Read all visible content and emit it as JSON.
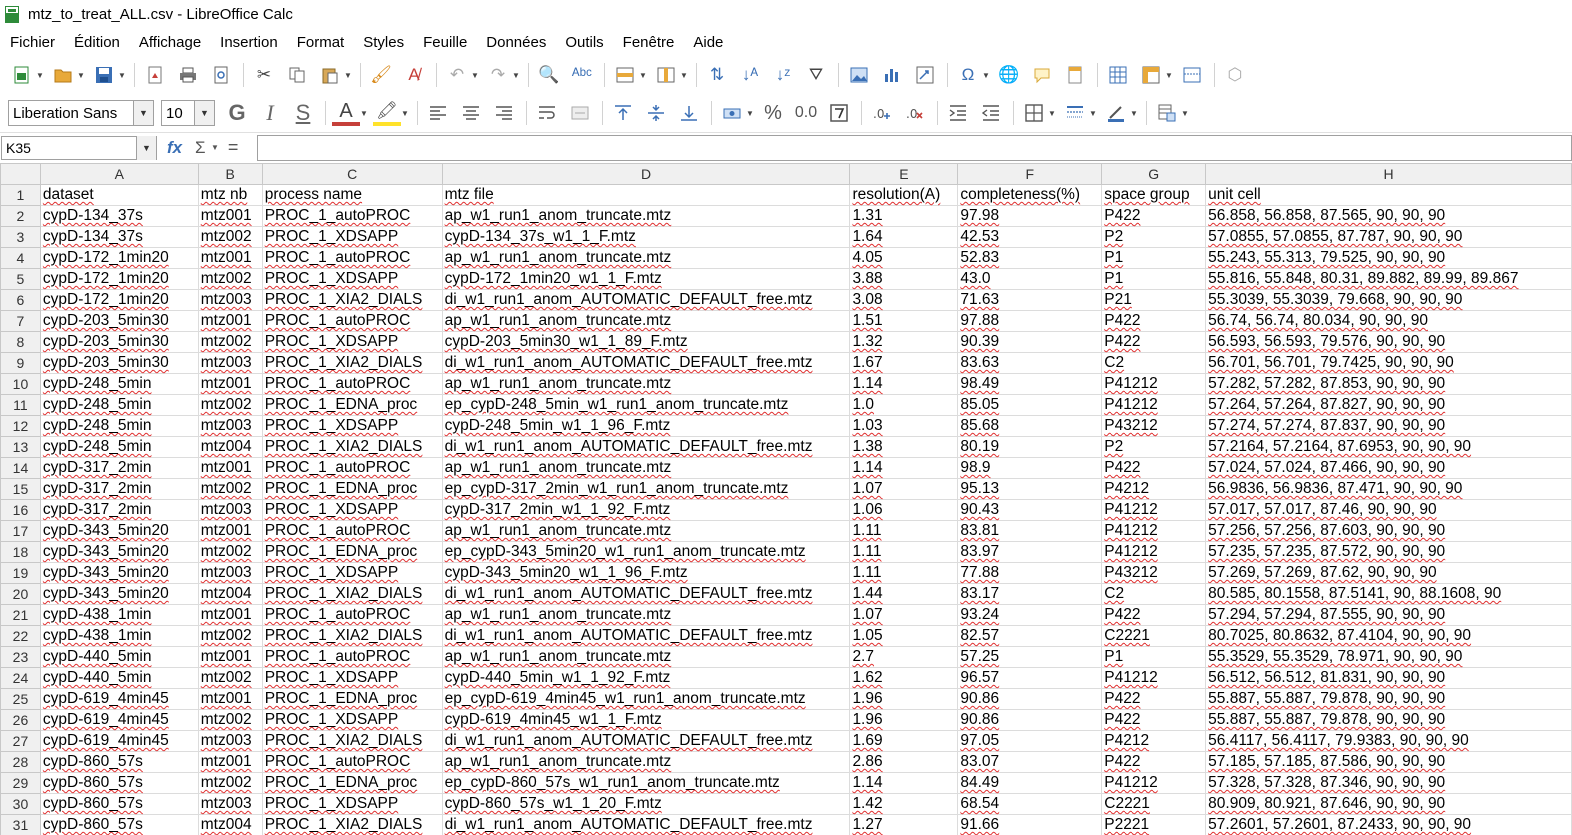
{
  "window": {
    "title": "mtz_to_treat_ALL.csv - LibreOffice Calc"
  },
  "menu": [
    "Fichier",
    "Édition",
    "Affichage",
    "Insertion",
    "Format",
    "Styles",
    "Feuille",
    "Données",
    "Outils",
    "Fenêtre",
    "Aide"
  ],
  "format_toolbar": {
    "font_name": "Liberation Sans",
    "font_size": "10",
    "percent_label": "%",
    "decimal_label": "0.0"
  },
  "formula_bar": {
    "cell_ref": "K35",
    "formula": ""
  },
  "columns": [
    "A",
    "B",
    "C",
    "D",
    "E",
    "F",
    "G",
    "H"
  ],
  "header_row": [
    "dataset",
    "mtz nb",
    "process name",
    "mtz file",
    "resolution(A)",
    "completeness(%)",
    "space group",
    "unit cell"
  ],
  "rows": [
    [
      "cypD-134_37s",
      "mtz001",
      "PROC_1_autoPROC",
      "ap_w1_run1_anom_truncate.mtz",
      "1.31",
      "97.98",
      "P422",
      "56.858, 56.858, 87.565, 90, 90, 90"
    ],
    [
      "cypD-134_37s",
      "mtz002",
      "PROC_1_XDSAPP",
      "cypD-134_37s_w1_1_F.mtz",
      "1.64",
      "42.53",
      "P2",
      "57.0855, 57.0855, 87.787, 90, 90, 90"
    ],
    [
      "cypD-172_1min20",
      "mtz001",
      "PROC_1_autoPROC",
      "ap_w1_run1_anom_truncate.mtz",
      "4.05",
      "52.83",
      "P1",
      "55.243, 55.313, 79.525, 90, 90, 90"
    ],
    [
      "cypD-172_1min20",
      "mtz002",
      "PROC_1_XDSAPP",
      "cypD-172_1min20_w1_1_F.mtz",
      "3.88",
      "43.0",
      "P1",
      "55.816, 55.848, 80.31, 89.882, 89.99, 89.867"
    ],
    [
      "cypD-172_1min20",
      "mtz003",
      "PROC_1_XIA2_DIALS",
      "di_w1_run1_anom_AUTOMATIC_DEFAULT_free.mtz",
      "3.08",
      "71.63",
      "P21",
      "55.3039, 55.3039, 79.668, 90, 90, 90"
    ],
    [
      "cypD-203_5min30",
      "mtz001",
      "PROC_1_autoPROC",
      "ap_w1_run1_anom_truncate.mtz",
      "1.51",
      "97.88",
      "P422",
      "56.74, 56.74, 80.034, 90, 90, 90"
    ],
    [
      "cypD-203_5min30",
      "mtz002",
      "PROC_1_XDSAPP",
      "cypD-203_5min30_w1_1_89_F.mtz",
      "1.32",
      "90.39",
      "P422",
      "56.593, 56.593, 79.576, 90, 90, 90"
    ],
    [
      "cypD-203_5min30",
      "mtz003",
      "PROC_1_XIA2_DIALS",
      "di_w1_run1_anom_AUTOMATIC_DEFAULT_free.mtz",
      "1.67",
      "83.63",
      "C2",
      "56.701, 56.701, 79.7425, 90, 90, 90"
    ],
    [
      "cypD-248_5min",
      "mtz001",
      "PROC_1_autoPROC",
      "ap_w1_run1_anom_truncate.mtz",
      "1.14",
      "98.49",
      "P41212",
      "57.282, 57.282, 87.853, 90, 90, 90"
    ],
    [
      "cypD-248_5min",
      "mtz002",
      "PROC_1_EDNA_proc",
      "ep_cypD-248_5min_w1_run1_anom_truncate.mtz",
      "1.0",
      "85.05",
      "P41212",
      "57.264, 57.264, 87.827, 90, 90, 90"
    ],
    [
      "cypD-248_5min",
      "mtz003",
      "PROC_1_XDSAPP",
      "cypD-248_5min_w1_1_96_F.mtz",
      "1.03",
      "85.68",
      "P43212",
      "57.274, 57.274, 87.837, 90, 90, 90"
    ],
    [
      "cypD-248_5min",
      "mtz004",
      "PROC_1_XIA2_DIALS",
      "di_w1_run1_anom_AUTOMATIC_DEFAULT_free.mtz",
      "1.38",
      "80.19",
      "P2",
      "57.2164, 57.2164, 87.6953, 90, 90, 90"
    ],
    [
      "cypD-317_2min",
      "mtz001",
      "PROC_1_autoPROC",
      "ap_w1_run1_anom_truncate.mtz",
      "1.14",
      "98.9",
      "P422",
      "57.024, 57.024, 87.466, 90, 90, 90"
    ],
    [
      "cypD-317_2min",
      "mtz002",
      "PROC_1_EDNA_proc",
      "ep_cypD-317_2min_w1_run1_anom_truncate.mtz",
      "1.07",
      "95.13",
      "P4212",
      "56.9836, 56.9836, 87.471, 90, 90, 90"
    ],
    [
      "cypD-317_2min",
      "mtz003",
      "PROC_1_XDSAPP",
      "cypD-317_2min_w1_1_92_F.mtz",
      "1.06",
      "90.43",
      "P41212",
      "57.017, 57.017, 87.46, 90, 90, 90"
    ],
    [
      "cypD-343_5min20",
      "mtz001",
      "PROC_1_autoPROC",
      "ap_w1_run1_anom_truncate.mtz",
      "1.11",
      "83.81",
      "P41212",
      "57.256, 57.256, 87.603, 90, 90, 90"
    ],
    [
      "cypD-343_5min20",
      "mtz002",
      "PROC_1_EDNA_proc",
      "ep_cypD-343_5min20_w1_run1_anom_truncate.mtz",
      "1.11",
      "83.97",
      "P41212",
      "57.235, 57.235, 87.572, 90, 90, 90"
    ],
    [
      "cypD-343_5min20",
      "mtz003",
      "PROC_1_XDSAPP",
      "cypD-343_5min20_w1_1_96_F.mtz",
      "1.11",
      "77.88",
      "P43212",
      "57.269, 57.269, 87.62, 90, 90, 90"
    ],
    [
      "cypD-343_5min20",
      "mtz004",
      "PROC_1_XIA2_DIALS",
      "di_w1_run1_anom_AUTOMATIC_DEFAULT_free.mtz",
      "1.44",
      "83.17",
      "C2",
      "80.585, 80.1558, 87.5141, 90, 88.1608, 90"
    ],
    [
      "cypD-438_1min",
      "mtz001",
      "PROC_1_autoPROC",
      "ap_w1_run1_anom_truncate.mtz",
      "1.07",
      "93.24",
      "P422",
      "57.294, 57.294, 87.555, 90, 90, 90"
    ],
    [
      "cypD-438_1min",
      "mtz002",
      "PROC_1_XIA2_DIALS",
      "di_w1_run1_anom_AUTOMATIC_DEFAULT_free.mtz",
      "1.05",
      "82.57",
      "C2221",
      "80.7025, 80.8632, 87.4104, 90, 90, 90"
    ],
    [
      "cypD-440_5min",
      "mtz001",
      "PROC_1_autoPROC",
      "ap_w1_run1_anom_truncate.mtz",
      "2.7",
      "57.25",
      "P1",
      "55.3529, 55.3529, 78.971, 90, 90, 90"
    ],
    [
      "cypD-440_5min",
      "mtz002",
      "PROC_1_XDSAPP",
      "cypD-440_5min_w1_1_92_F.mtz",
      "1.62",
      "96.57",
      "P41212",
      "56.512, 56.512, 81.831, 90, 90, 90"
    ],
    [
      "cypD-619_4min45",
      "mtz001",
      "PROC_1_EDNA_proc",
      "ep_cypD-619_4min45_w1_run1_anom_truncate.mtz",
      "1.96",
      "90.86",
      "P422",
      "55.887, 55.887, 79.878, 90, 90, 90"
    ],
    [
      "cypD-619_4min45",
      "mtz002",
      "PROC_1_XDSAPP",
      "cypD-619_4min45_w1_1_F.mtz",
      "1.96",
      "90.86",
      "P422",
      "55.887, 55.887, 79.878, 90, 90, 90"
    ],
    [
      "cypD-619_4min45",
      "mtz003",
      "PROC_1_XIA2_DIALS",
      "di_w1_run1_anom_AUTOMATIC_DEFAULT_free.mtz",
      "1.69",
      "97.05",
      "P4212",
      "56.4117, 56.4117, 79.9383, 90, 90, 90"
    ],
    [
      "cypD-860_57s",
      "mtz001",
      "PROC_1_autoPROC",
      "ap_w1_run1_anom_truncate.mtz",
      "2.86",
      "83.07",
      "P422",
      "57.185, 57.185, 87.586, 90, 90, 90"
    ],
    [
      "cypD-860_57s",
      "mtz002",
      "PROC_1_EDNA_proc",
      "ep_cypD-860_57s_w1_run1_anom_truncate.mtz",
      "1.14",
      "84.49",
      "P41212",
      "57.328, 57.328, 87.346, 90, 90, 90"
    ],
    [
      "cypD-860_57s",
      "mtz003",
      "PROC_1_XDSAPP",
      "cypD-860_57s_w1_1_20_F.mtz",
      "1.42",
      "68.54",
      "C2221",
      "80.909, 80.921, 87.646, 90, 90, 90"
    ],
    [
      "cypD-860_57s",
      "mtz004",
      "PROC_1_XIA2_DIALS",
      "di_w1_run1_anom_AUTOMATIC_DEFAULT_free.mtz",
      "1.27",
      "91.66",
      "P2221",
      "57.2601, 57.2601, 87.2433, 90, 90, 90"
    ]
  ]
}
